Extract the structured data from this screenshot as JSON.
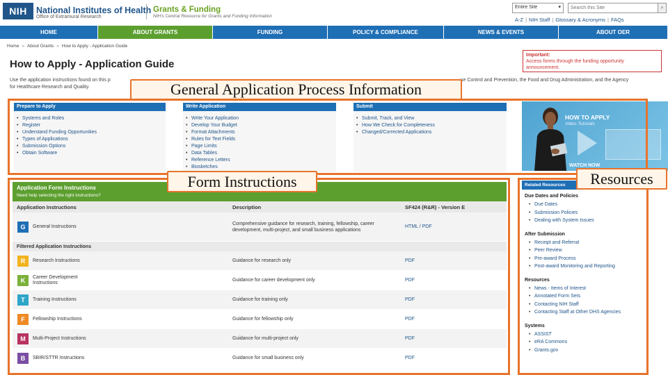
{
  "header": {
    "nih_logo": "NIH",
    "org_name": "National Institutes of Health",
    "org_sub": "Office of Extramural Research",
    "site_title": "Grants & Funding",
    "site_sub": "NIH's Central Resource for Grants and Funding Information",
    "scope_value": "Entire Site",
    "search_placeholder": "Search this Site",
    "util_links": [
      "A-Z",
      "NIH Staff",
      "Glossary & Acronyms",
      "FAQs"
    ]
  },
  "nav": [
    "HOME",
    "ABOUT GRANTS",
    "FUNDING",
    "POLICY & COMPLIANCE",
    "NEWS & EVENTS",
    "ABOUT OER"
  ],
  "breadcrumb": [
    "Home",
    "About Grants",
    "How to Apply - Application Guide"
  ],
  "page_title": "How to Apply - Application Guide",
  "intro_start": "Use the application instructions found on this p",
  "intro_end": "se Control and Prevention, the Food and Drug Administration, and the Agency",
  "intro_line2": "for Healthcare Research and Quality.",
  "important": {
    "title": "Important:",
    "text": "Access forms through the funding opportunity announcement."
  },
  "columns": [
    {
      "title": "Prepare to Apply",
      "items": [
        "Systems and Roles",
        "Register",
        "Understand Funding Opportunities",
        "Types of Applications",
        "Submission Options",
        "Obtain Software"
      ]
    },
    {
      "title": "Write Application",
      "items": [
        "Write Your Application",
        "Develop Your Budget",
        "Format Attachments",
        "Rules for Text Fields",
        "Page Limits",
        "Data Tables",
        "Reference Letters",
        "Biosketches"
      ]
    },
    {
      "title": "Submit",
      "items": [
        "Submit, Track, and View",
        "How We Check for Completeness",
        "Changed/Corrected Applications"
      ]
    }
  ],
  "promo": {
    "title": "HOW TO APPLY",
    "subtitle": "Video Tutorials",
    "watch": "WATCH NOW"
  },
  "form": {
    "title": "Application Form Instructions",
    "subtitle": "Need help selecting the right instructions?",
    "col_instructions": "Application Instructions",
    "col_description": "Description",
    "col_version": "SF424 (R&R) - Version E",
    "general": {
      "badge": "G",
      "name": "General Instructions",
      "desc": "Comprehensive guidance for research, training, fellowship, career development, multi-project, and small business applications",
      "link": "HTML / PDF",
      "color": "#1f6fb5"
    },
    "filtered_title": "Filtered Application Instructions",
    "filtered": [
      {
        "badge": "R",
        "name": "Research Instructions",
        "desc": "Guidance for research only",
        "link": "PDF",
        "color": "#f2b31e"
      },
      {
        "badge": "K",
        "name": "Career Development Instructions",
        "desc": "Guidance for career development only",
        "link": "PDF",
        "color": "#7bb13a"
      },
      {
        "badge": "T",
        "name": "Training Instructions",
        "desc": "Guidance for training only",
        "link": "PDF",
        "color": "#2ea6c9"
      },
      {
        "badge": "F",
        "name": "Fellowship Instructions",
        "desc": "Guidance for fellowship only",
        "link": "PDF",
        "color": "#f08a24"
      },
      {
        "badge": "M",
        "name": "Multi-Project Instructions",
        "desc": "Guidance for multi-project only",
        "link": "PDF",
        "color": "#b8325e"
      },
      {
        "badge": "B",
        "name": "SBIR/STTR Instructions",
        "desc": "Guidance for small business only",
        "link": "PDF",
        "color": "#7a4ea3"
      }
    ]
  },
  "resources": {
    "title": "Related Resources",
    "sections": [
      {
        "heading": "Due Dates and Policies",
        "items": [
          "Due Dates",
          "Submission Policies",
          "Dealing with System Issues"
        ]
      },
      {
        "heading": "After Submission",
        "items": [
          "Receipt and Referral",
          "Peer Review",
          "Pre-award Process",
          "Post-award Monitoring and Reporting"
        ]
      },
      {
        "heading": "Resources",
        "items": [
          "News - Items of Interest",
          "Annotated Form Sets",
          "Contacting NIH Staff",
          "Contacting Staff at Other DHS Agencies"
        ]
      },
      {
        "heading": "Systems",
        "items": [
          "ASSIST",
          "eRA Commons",
          "Grants.gov"
        ]
      }
    ]
  },
  "overlays": {
    "general_label": "General Application Process Information",
    "form_label": "Form Instructions",
    "resources_label": "Resources",
    "color": "#e8742b"
  }
}
